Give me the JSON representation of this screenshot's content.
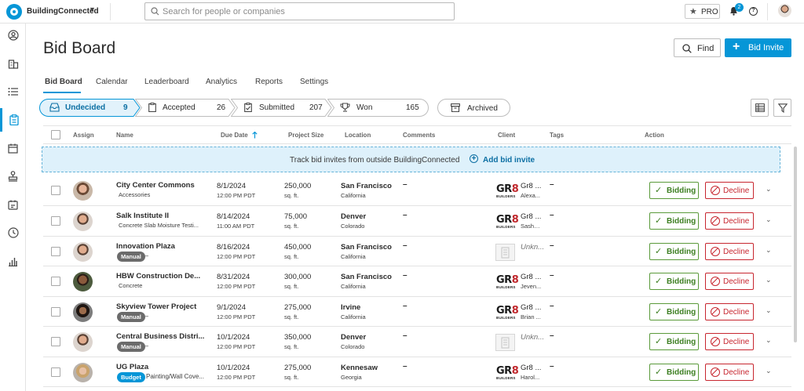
{
  "app": {
    "brand": "BuildingConnected"
  },
  "search": {
    "placeholder": "Search for people or companies"
  },
  "topbar": {
    "pro_label": "PRO",
    "notifications": "2"
  },
  "page": {
    "title": "Bid Board",
    "find_label": "Find",
    "invite_label": "Bid Invite"
  },
  "tabs": [
    "Bid Board",
    "Calendar",
    "Leaderboard",
    "Analytics",
    "Reports",
    "Settings"
  ],
  "statuses": [
    {
      "label": "Undecided",
      "count": "9",
      "active": true
    },
    {
      "label": "Accepted",
      "count": "26",
      "active": false
    },
    {
      "label": "Submitted",
      "count": "207",
      "active": false
    },
    {
      "label": "Won",
      "count": "165",
      "active": false
    }
  ],
  "archived_label": "Archived",
  "columns": {
    "assign": "Assign",
    "name": "Name",
    "due": "Due Date",
    "size": "Project Size",
    "location": "Location",
    "comments": "Comments",
    "client": "Client",
    "tags": "Tags",
    "action": "Action"
  },
  "banner": {
    "text": "Track bid invites from outside BuildingConnected",
    "add": "Add bid invite"
  },
  "actions": {
    "bidding": "Bidding",
    "decline": "Decline"
  },
  "rows": [
    {
      "name": "City Center Commons",
      "sub": "Accessories",
      "tag": "",
      "due": "8/1/2024",
      "time": "12:00 PM PDT",
      "size": "250,000",
      "unit": "sq. ft.",
      "city": "San Francisco",
      "state": "California",
      "comment": "–",
      "client": "Gr8 ...",
      "contact": "Alexa...",
      "client_logo": "gr8",
      "tags": "–",
      "avatar": "woman-glasses"
    },
    {
      "name": "Salk Institute II",
      "sub": "Concrete Slab Moisture Testi...",
      "tag": "",
      "due": "8/14/2024",
      "time": "11:00 AM PDT",
      "size": "75,000",
      "unit": "sq. ft.",
      "city": "Denver",
      "state": "Colorado",
      "comment": "–",
      "client": "Gr8 ...",
      "contact": "Sasha...",
      "client_logo": "gr8",
      "tags": "–",
      "avatar": "man-beard"
    },
    {
      "name": "Innovation Plaza",
      "sub": "–",
      "tag": "Manual",
      "due": "8/16/2024",
      "time": "12:00 PM PDT",
      "size": "450,000",
      "unit": "sq. ft.",
      "city": "San Francisco",
      "state": "California",
      "comment": "–",
      "client": "Unkn...",
      "contact": "",
      "client_logo": "unknown",
      "tags": "–",
      "avatar": "man-beard"
    },
    {
      "name": "HBW Construction De...",
      "sub": "Concrete",
      "tag": "",
      "due": "8/31/2024",
      "time": "12:00 PM PDT",
      "size": "300,000",
      "unit": "sq. ft.",
      "city": "San Francisco",
      "state": "California",
      "comment": "–",
      "client": "Gr8 ...",
      "contact": "Jeven...",
      "client_logo": "gr8",
      "tags": "–",
      "avatar": "man-dark"
    },
    {
      "name": "Skyview Tower Project",
      "sub": "–",
      "tag": "Manual",
      "due": "9/1/2024",
      "time": "12:00 PM PDT",
      "size": "275,000",
      "unit": "sq. ft.",
      "city": "Irvine",
      "state": "California",
      "comment": "–",
      "client": "Gr8 ...",
      "contact": "Brian ...",
      "client_logo": "gr8",
      "tags": "–",
      "avatar": "woman-dark"
    },
    {
      "name": "Central Business Distri...",
      "sub": "–",
      "tag": "Manual",
      "due": "10/1/2024",
      "time": "12:00 PM PDT",
      "size": "350,000",
      "unit": "sq. ft.",
      "city": "Denver",
      "state": "Colorado",
      "comment": "–",
      "client": "Unkn...",
      "contact": "",
      "client_logo": "unknown",
      "tags": "–",
      "avatar": "man-beard"
    },
    {
      "name": "UG Plaza",
      "sub": "Painting/Wall Cove...",
      "tag": "Budget",
      "due": "10/1/2024",
      "time": "12:00 PM PDT",
      "size": "275,000",
      "unit": "sq. ft.",
      "city": "Kennesaw",
      "state": "Georgia",
      "comment": "–",
      "client": "Gr8 ...",
      "contact": "Harol...",
      "client_logo": "gr8",
      "tags": "–",
      "avatar": "woman-blonde"
    }
  ]
}
